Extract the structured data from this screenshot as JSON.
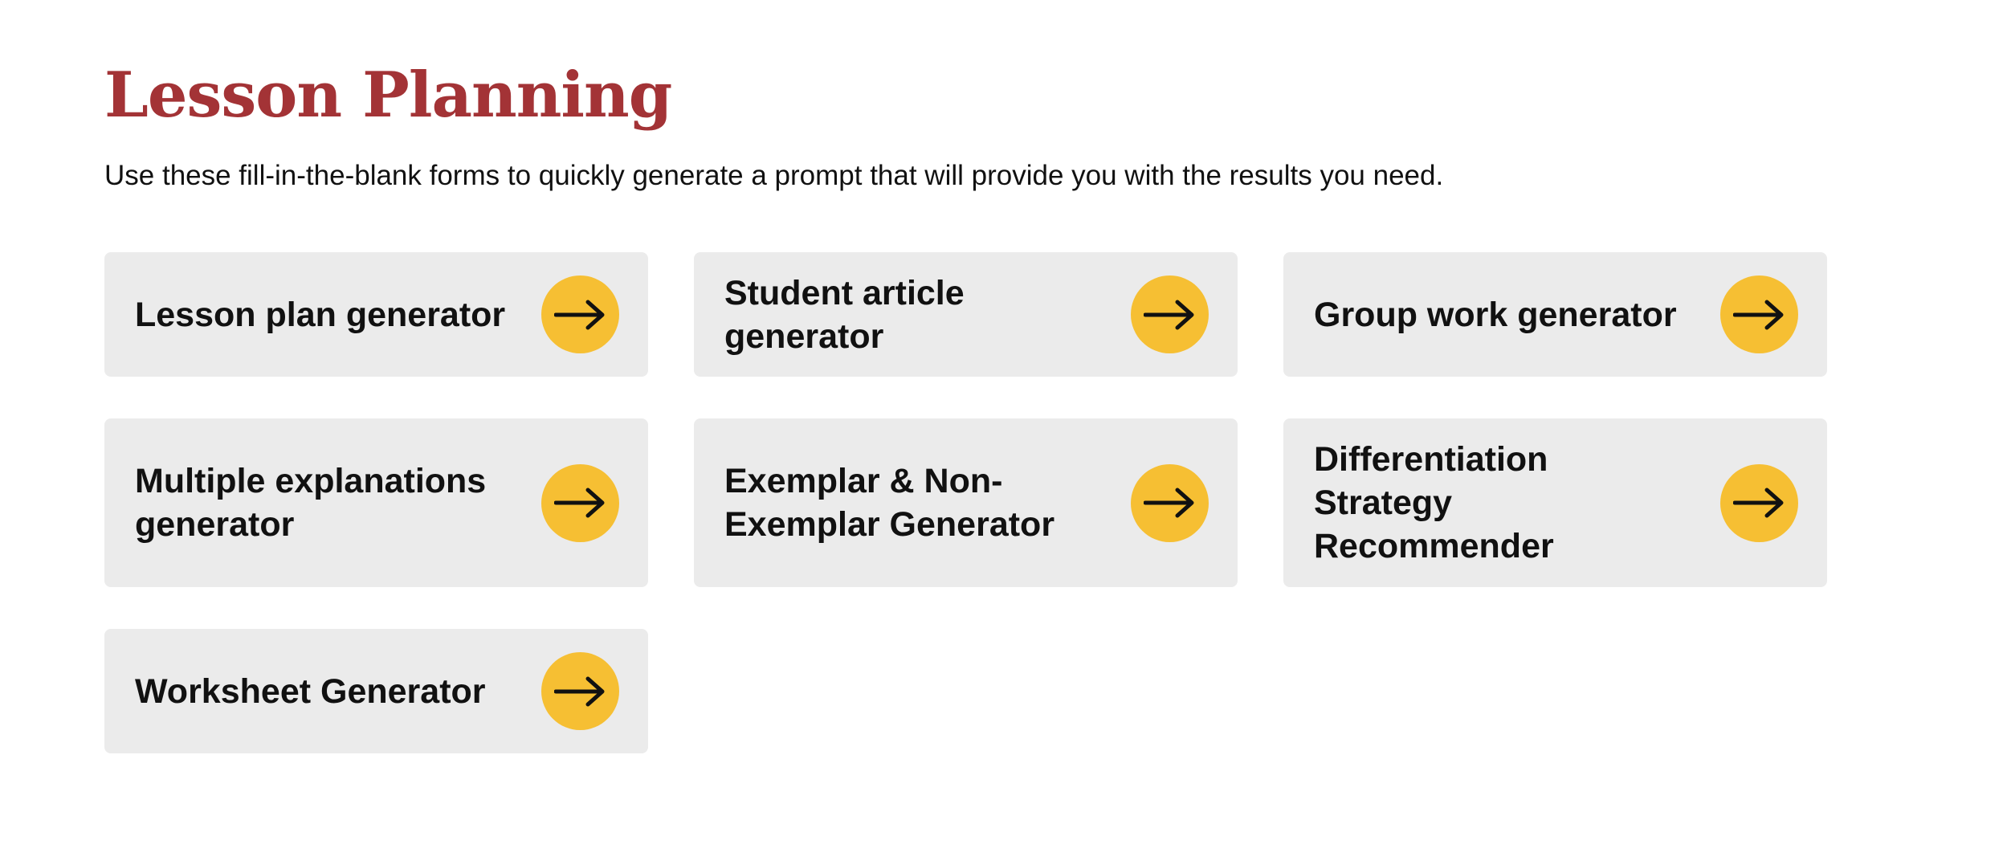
{
  "header": {
    "title": "Lesson Planning",
    "subtitle": "Use these fill-in-the-blank forms to quickly generate a prompt that will provide you with the results you need."
  },
  "cards": [
    {
      "label": "Lesson plan generator",
      "icon": "arrow-right-icon"
    },
    {
      "label": "Student article generator",
      "icon": "arrow-right-icon"
    },
    {
      "label": "Group work generator",
      "icon": "arrow-right-icon"
    },
    {
      "label": "Multiple explanations generator",
      "icon": "arrow-right-icon"
    },
    {
      "label": "Exemplar & Non-Exemplar Generator",
      "icon": "arrow-right-icon"
    },
    {
      "label": "Differentiation Strategy Recommender",
      "icon": "arrow-right-icon"
    },
    {
      "label": "Worksheet Generator",
      "icon": "arrow-right-icon"
    }
  ],
  "colors": {
    "title": "#a33336",
    "card_background": "#ebebeb",
    "arrow_circle": "#f6bf33",
    "text": "#111111"
  }
}
